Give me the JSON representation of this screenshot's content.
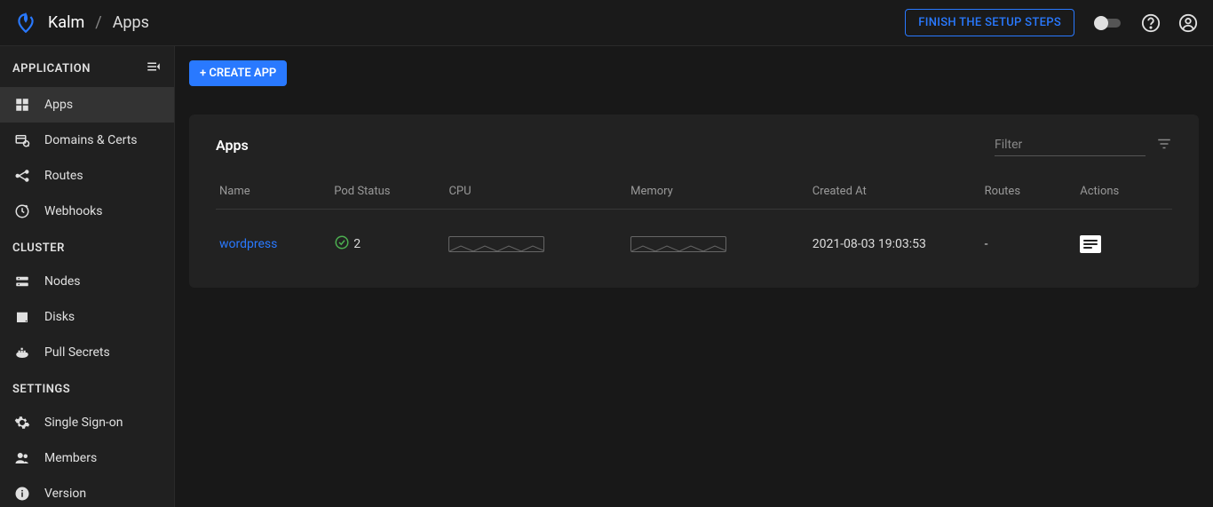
{
  "topbar": {
    "brand": "Kalm",
    "breadcrumb_current": "Apps",
    "finish_setup": "FINISH THE SETUP STEPS"
  },
  "sidebar": {
    "sections": {
      "application": {
        "label": "APPLICATION"
      },
      "cluster": {
        "label": "CLUSTER"
      },
      "settings": {
        "label": "SETTINGS"
      }
    },
    "items": {
      "apps": "Apps",
      "domains": "Domains & Certs",
      "routes": "Routes",
      "webhooks": "Webhooks",
      "nodes": "Nodes",
      "disks": "Disks",
      "pullsecrets": "Pull Secrets",
      "sso": "Single Sign-on",
      "members": "Members",
      "version": "Version"
    }
  },
  "main": {
    "create_app": "+ CREATE APP",
    "card_title": "Apps",
    "filter_placeholder": "Filter",
    "columns": {
      "name": "Name",
      "pod_status": "Pod Status",
      "cpu": "CPU",
      "memory": "Memory",
      "created_at": "Created At",
      "routes": "Routes",
      "actions": "Actions"
    },
    "rows": [
      {
        "name": "wordpress",
        "pod_count": "2",
        "created_at": "2021-08-03 19:03:53",
        "routes": "-"
      }
    ]
  },
  "colors": {
    "accent": "#2979ff",
    "success": "#4caf50"
  }
}
